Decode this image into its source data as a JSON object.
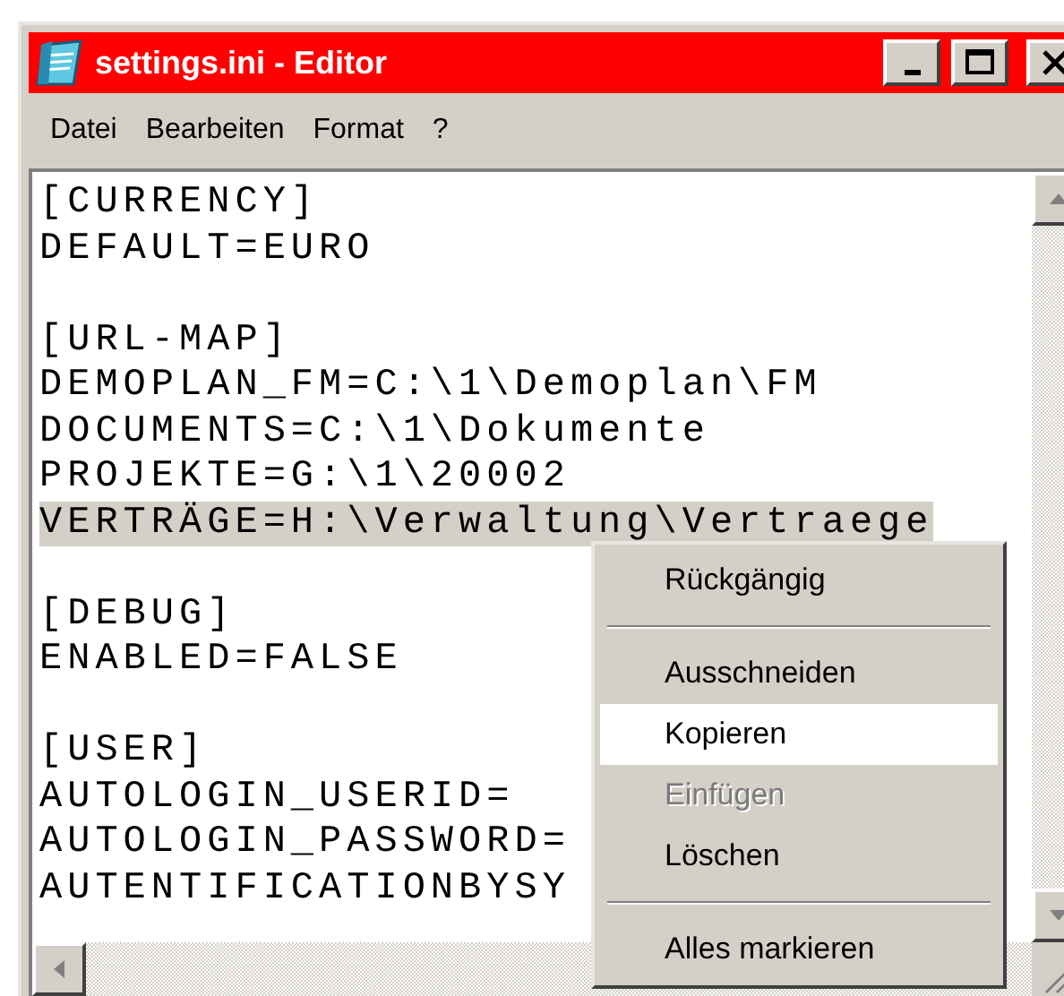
{
  "window": {
    "title": "settings.ini - Editor"
  },
  "menu_bar": [
    {
      "label": "Datei"
    },
    {
      "label": "Bearbeiten"
    },
    {
      "label": "Format"
    },
    {
      "label": "?"
    }
  ],
  "document": {
    "sections": [
      {
        "header": "[CURRENCY]",
        "lines": [
          {
            "text": "DEFAULT=EURO",
            "selected": false
          }
        ]
      },
      {
        "header": "[URL-MAP]",
        "lines": [
          {
            "text": "DEMOPLAN_FM=C:\\1\\Demoplan\\FM",
            "selected": false
          },
          {
            "text": "DOCUMENTS=C:\\1\\Dokumente",
            "selected": false
          },
          {
            "text": "PROJEKTE=G:\\1\\20002",
            "selected": false
          },
          {
            "text": "VERTRÄGE=H:\\Verwaltung\\Vertraege",
            "selected": true
          }
        ]
      },
      {
        "header": "[DEBUG]",
        "lines": [
          {
            "text": "ENABLED=FALSE",
            "selected": false
          }
        ]
      },
      {
        "header": "[USER]",
        "lines": [
          {
            "text": "AUTOLOGIN_USERID=",
            "selected": false
          },
          {
            "text": "AUTOLOGIN_PASSWORD=",
            "selected": false
          },
          {
            "text": "AUTENTIFICATIONBYSY",
            "selected": false
          }
        ]
      }
    ]
  },
  "context_menu": [
    {
      "kind": "item",
      "label": "Rückgängig",
      "disabled": false,
      "selected": false
    },
    {
      "kind": "separator"
    },
    {
      "kind": "item",
      "label": "Ausschneiden",
      "disabled": false,
      "selected": false
    },
    {
      "kind": "item",
      "label": "Kopieren",
      "disabled": false,
      "selected": true
    },
    {
      "kind": "item",
      "label": "Einfügen",
      "disabled": true,
      "selected": false
    },
    {
      "kind": "item",
      "label": "Löschen",
      "disabled": false,
      "selected": false
    },
    {
      "kind": "separator"
    },
    {
      "kind": "item",
      "label": "Alles markieren",
      "disabled": false,
      "selected": false
    }
  ]
}
